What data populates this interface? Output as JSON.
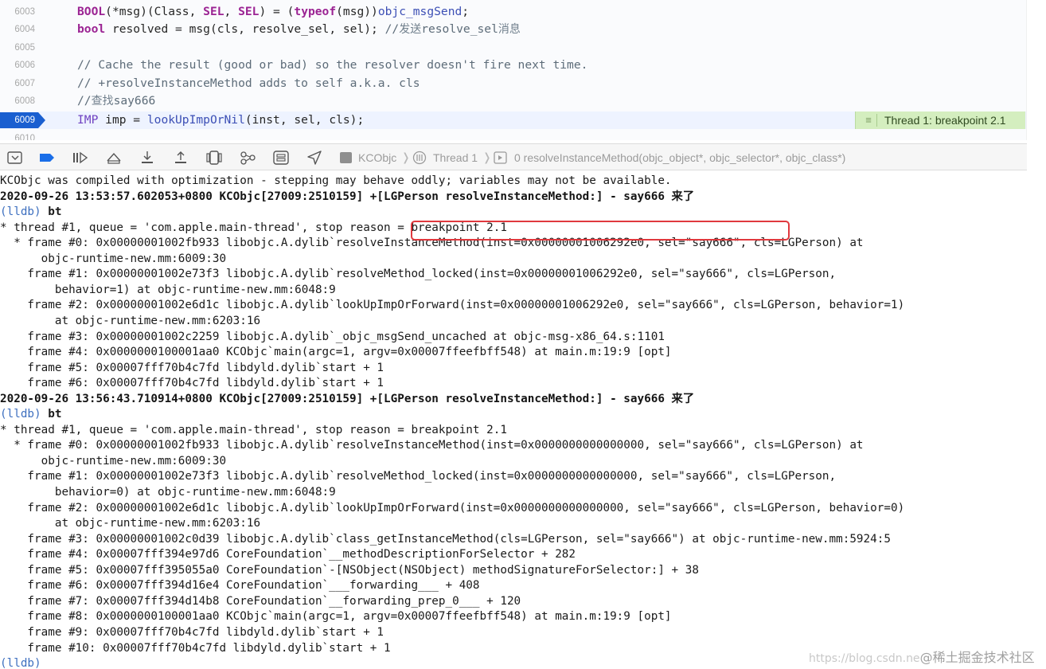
{
  "editor": {
    "lines": [
      {
        "num": "6003",
        "parts": [
          [
            "kw",
            "BOOL"
          ],
          [
            "",
            "(*msg)(Class, "
          ],
          [
            "kw",
            "SEL"
          ],
          [
            "",
            ", "
          ],
          [
            "kw",
            "SEL"
          ],
          [
            "",
            ") = ("
          ],
          [
            "kw",
            "typeof"
          ],
          [
            "",
            "(msg))"
          ],
          [
            "fn",
            "objc_msgSend"
          ],
          [
            "",
            ";"
          ]
        ]
      },
      {
        "num": "6004",
        "parts": [
          [
            "kw",
            "bool"
          ],
          [
            "",
            "resolved = msg(cls, resolve_sel, sel); "
          ],
          [
            "cm",
            "//"
          ],
          [
            "cm-cn",
            "发送"
          ],
          [
            "cm",
            "resolve_sel"
          ],
          [
            "cm-cn",
            "消息"
          ]
        ]
      },
      {
        "num": "6005",
        "parts": []
      },
      {
        "num": "6006",
        "parts": [
          [
            "cm",
            "// Cache the result (good or bad) so the resolver doesn't fire next time."
          ]
        ]
      },
      {
        "num": "6007",
        "parts": [
          [
            "cm",
            "// +resolveInstanceMethod adds to self a.k.a. cls"
          ]
        ]
      },
      {
        "num": "6008",
        "parts": [
          [
            "cm",
            "//"
          ],
          [
            "cm-cn",
            "查找"
          ],
          [
            "cm",
            "say666"
          ]
        ]
      },
      {
        "num": "6009",
        "parts": [
          [
            "ty",
            "IMP"
          ],
          [
            "",
            "imp = "
          ],
          [
            "fn",
            "lookUpImpOrNil"
          ],
          [
            "",
            "(inst, sel, cls);"
          ]
        ],
        "current": true
      },
      {
        "num": "6010",
        "parts": []
      }
    ],
    "thread_banner": "Thread 1: breakpoint 2.1",
    "banner_icon": "equal-bars-icon",
    "breakpoint_color": "#1a5fd0",
    "banner_color": "#d4eebf"
  },
  "debug_bar": {
    "icons": [
      "hide-debug-area-icon",
      "breakpoints-toggle-icon",
      "continue-icon",
      "step-over-icon",
      "step-into-icon",
      "step-out-icon",
      "view-hierarchy-icon",
      "memory-graph-icon",
      "environment-overrides-icon",
      "simulate-location-icon"
    ],
    "breadcrumb": {
      "target": "KCObjc",
      "thread": "Thread 1",
      "frame": "0 resolveInstanceMethod(objc_object*, objc_selector*, objc_class*)"
    }
  },
  "console": {
    "lines": [
      {
        "text": "KCObjc was compiled with optimization - stepping may behave oddly; variables may not be available."
      },
      {
        "text": "2020-09-26 13:53:57.602053+0800 KCObjc[27009:2510159] +[LGPerson resolveInstanceMethod:] - say666 ",
        "cn": "来了",
        "bold": true
      },
      {
        "prompt": "(lldb) ",
        "text": "bt"
      },
      {
        "text": "* thread #1, queue = 'com.apple.main-thread', stop reason = breakpoint 2.1"
      },
      {
        "text": "  * frame #0: 0x00000001002fb933 libobjc.A.dylib`resolveInstanceMethod(inst=0x00000001006292e0, sel=\"say666\", cls=LGPerson) at"
      },
      {
        "text": "      objc-runtime-new.mm:6009:30"
      },
      {
        "text": "    frame #1: 0x00000001002e73f3 libobjc.A.dylib`resolveMethod_locked(inst=0x00000001006292e0, sel=\"say666\", cls=LGPerson,"
      },
      {
        "text": "        behavior=1) at objc-runtime-new.mm:6048:9"
      },
      {
        "text": "    frame #2: 0x00000001002e6d1c libobjc.A.dylib`lookUpImpOrForward(inst=0x00000001006292e0, sel=\"say666\", cls=LGPerson, behavior=1)"
      },
      {
        "text": "        at objc-runtime-new.mm:6203:16"
      },
      {
        "text": "    frame #3: 0x00000001002c2259 libobjc.A.dylib`_objc_msgSend_uncached at objc-msg-x86_64.s:1101"
      },
      {
        "text": "    frame #4: 0x0000000100001aa0 KCObjc`main(argc=1, argv=0x00007ffeefbff548) at main.m:19:9 [opt]"
      },
      {
        "text": "    frame #5: 0x00007fff70b4c7fd libdyld.dylib`start + 1"
      },
      {
        "text": "    frame #6: 0x00007fff70b4c7fd libdyld.dylib`start + 1"
      },
      {
        "text": "2020-09-26 13:56:43.710914+0800 KCObjc[27009:2510159] +[LGPerson resolveInstanceMethod:] - say666 ",
        "cn": "来了",
        "bold": true
      },
      {
        "prompt": "(lldb) ",
        "text": "bt"
      },
      {
        "text": "* thread #1, queue = 'com.apple.main-thread', stop reason = breakpoint 2.1"
      },
      {
        "text": "  * frame #0: 0x00000001002fb933 libobjc.A.dylib`resolveInstanceMethod(inst=0x0000000000000000, sel=\"say666\", cls=LGPerson) at"
      },
      {
        "text": "      objc-runtime-new.mm:6009:30"
      },
      {
        "text": "    frame #1: 0x00000001002e73f3 libobjc.A.dylib`resolveMethod_locked(inst=0x0000000000000000, sel=\"say666\", cls=LGPerson,"
      },
      {
        "text": "        behavior=0) at objc-runtime-new.mm:6048:9"
      },
      {
        "text": "    frame #2: 0x00000001002e6d1c libobjc.A.dylib`lookUpImpOrForward(inst=0x0000000000000000, sel=\"say666\", cls=LGPerson, behavior=0)"
      },
      {
        "text": "        at objc-runtime-new.mm:6203:16"
      },
      {
        "text": "    frame #3: 0x00000001002c0d39 libobjc.A.dylib`class_getInstanceMethod(cls=LGPerson, sel=\"say666\") at objc-runtime-new.mm:5924:5"
      },
      {
        "text": "    frame #4: 0x00007fff394e97d6 CoreFoundation`__methodDescriptionForSelector + 282"
      },
      {
        "text": "    frame #5: 0x00007fff395055a0 CoreFoundation`-[NSObject(NSObject) methodSignatureForSelector:] + 38"
      },
      {
        "text": "    frame #6: 0x00007fff394d16e4 CoreFoundation`___forwarding___ + 408"
      },
      {
        "text": "    frame #7: 0x00007fff394d14b8 CoreFoundation`__forwarding_prep_0___ + 120"
      },
      {
        "text": "    frame #8: 0x0000000100001aa0 KCObjc`main(argc=1, argv=0x00007ffeefbff548) at main.m:19:9 [opt]"
      },
      {
        "text": "    frame #9: 0x00007fff70b4c7fd libdyld.dylib`start + 1"
      },
      {
        "text": "    frame #10: 0x00007fff70b4c7fd libdyld.dylib`start + 1"
      },
      {
        "prompt": "(lldb)",
        "text": ""
      }
    ],
    "highlight_color": "#e0393e"
  },
  "watermark": {
    "url": "https://blog.csdn.ne",
    "brand": "@稀土掘金技术社区"
  }
}
